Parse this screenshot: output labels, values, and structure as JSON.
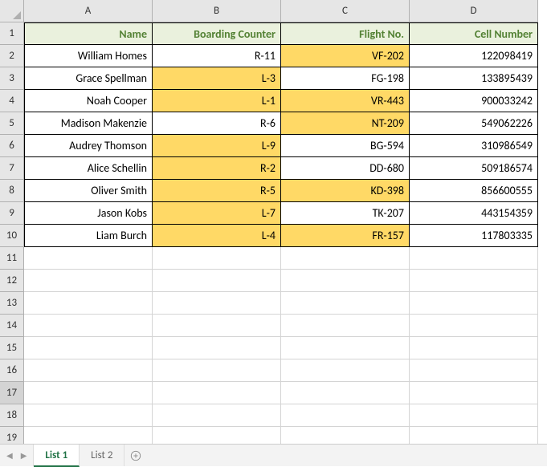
{
  "columns": [
    "A",
    "B",
    "C",
    "D"
  ],
  "row_count": 19,
  "selected_row": 17,
  "headers": {
    "name": "Name",
    "boarding": "Boarding Counter",
    "flight": "Flight No.",
    "cell": "Cell Number"
  },
  "rows": [
    {
      "name": "William Homes",
      "boarding": "R-11",
      "flight": "VF-202",
      "cell": "122098419",
      "hl_b": false,
      "hl_c": true
    },
    {
      "name": "Grace Spellman",
      "boarding": "L-3",
      "flight": "FG-198",
      "cell": "133895439",
      "hl_b": true,
      "hl_c": false
    },
    {
      "name": "Noah Cooper",
      "boarding": "L-1",
      "flight": "VR-443",
      "cell": "900033242",
      "hl_b": true,
      "hl_c": true
    },
    {
      "name": "Madison Makenzie",
      "boarding": "R-6",
      "flight": "NT-209",
      "cell": "549062226",
      "hl_b": false,
      "hl_c": true
    },
    {
      "name": "Audrey Thomson",
      "boarding": "L-9",
      "flight": "BG-594",
      "cell": "310986549",
      "hl_b": true,
      "hl_c": false
    },
    {
      "name": "Alice Schellin",
      "boarding": "R-2",
      "flight": "DD-680",
      "cell": "509186574",
      "hl_b": true,
      "hl_c": false
    },
    {
      "name": "Oliver Smith",
      "boarding": "R-5",
      "flight": "KD-398",
      "cell": "856600555",
      "hl_b": true,
      "hl_c": true
    },
    {
      "name": "Jason Kobs",
      "boarding": "L-7",
      "flight": "TK-207",
      "cell": "443154359",
      "hl_b": true,
      "hl_c": false
    },
    {
      "name": "Liam Burch",
      "boarding": "L-4",
      "flight": "FR-157",
      "cell": "117803335",
      "hl_b": true,
      "hl_c": true
    }
  ],
  "tabs": [
    {
      "label": "List 1",
      "active": true
    },
    {
      "label": "List 2",
      "active": false
    }
  ],
  "chart_data": {
    "type": "table",
    "title": "",
    "columns": [
      "Name",
      "Boarding Counter",
      "Flight No.",
      "Cell Number"
    ],
    "rows": [
      [
        "William Homes",
        "R-11",
        "VF-202",
        122098419
      ],
      [
        "Grace Spellman",
        "L-3",
        "FG-198",
        133895439
      ],
      [
        "Noah Cooper",
        "L-1",
        "VR-443",
        900033242
      ],
      [
        "Madison Makenzie",
        "R-6",
        "NT-209",
        549062226
      ],
      [
        "Audrey Thomson",
        "L-9",
        "BG-594",
        310986549
      ],
      [
        "Alice Schellin",
        "R-2",
        "DD-680",
        509186574
      ],
      [
        "Oliver Smith",
        "R-5",
        "KD-398",
        856600555
      ],
      [
        "Jason Kobs",
        "L-7",
        "TK-207",
        443154359
      ],
      [
        "Liam Burch",
        "L-4",
        "FR-157",
        117803335
      ]
    ]
  }
}
